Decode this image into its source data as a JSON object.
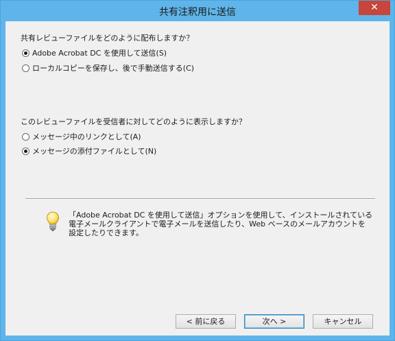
{
  "window": {
    "title": "共有注釈用に送信",
    "close_glyph": "✕"
  },
  "question1": {
    "label": "共有レビューファイルをどのように配布しますか？",
    "options": [
      {
        "label": "Adobe Acrobat DC を使用して送信(S)",
        "checked": true
      },
      {
        "label": "ローカルコピーを保存し、後で手動送信する(C)",
        "checked": false
      }
    ]
  },
  "question2": {
    "label": "このレビューファイルを受信者に対してどのように表示しますか？",
    "options": [
      {
        "label": "メッセージ中のリンクとして(A)",
        "checked": false
      },
      {
        "label": "メッセージの添付ファイルとして(N)",
        "checked": true
      }
    ]
  },
  "info": {
    "icon": "lightbulb-icon",
    "lines": [
      "「Adobe Acrobat DC を使用して送信」オプションを使用して、インストールされている",
      "電子メールクライアントで電子メールを送信したり、Web ベースのメールアカウントを",
      "設定したりできます。"
    ]
  },
  "buttons": {
    "back": "< 前に戻る",
    "next": "次へ >",
    "cancel": "キャンセル"
  },
  "colors": {
    "titlebar": "#5fb4ea",
    "close": "#c7453a",
    "client": "#f0f0f0"
  }
}
